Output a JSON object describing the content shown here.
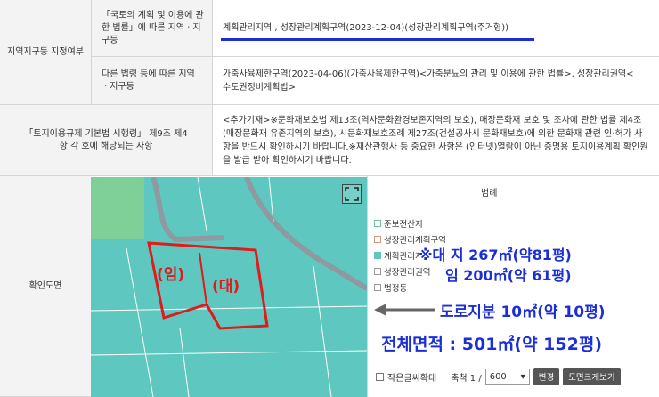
{
  "rows": {
    "zone_label": "지역지구등 지정여부",
    "sub1_label": "「국토의 계획 및 이용에 관한 법률」에 따른 지역ㆍ지구등",
    "sub1_value": "계획관리지역 , 성장관리계획구역(2023-12-04)(성장관리계획구역(주거형))",
    "sub2_label": "다른 법령 등에 따른 지역ㆍ지구등",
    "sub2_value": "가축사육제한구역(2023-04-06)(가축사육제한구역)<가축분뇨의 관리 및 이용에 관한 법률>, 성장관리권역<수도권정비계획법>",
    "reg_label": "「토지이용규제 기본법 시행령」 제9조 제4항 각 호에 해당되는 사항",
    "reg_value": "<추가기재>※문화재보호법 제13조(역사문화환경보존지역의 보호), 매장문화재 보호 및 조사에 관한 법률 제4조(매장문화재 유존지역의 보호), 시문화재보호조례 제27조(건설공사시 문화재보호)에 의한 문화재 관련 인·허가 사항을 반드시 확인하시기 바랍니다.※재산관행사 등 중요한 사항은 (인터넷)열람이 아닌 증명용 토지이용계획 확인원을 발급 받아 확인하시기 바랍니다.",
    "map_label": "확인도면"
  },
  "legend": {
    "title": "범례",
    "items": [
      {
        "label": "준보전산지",
        "color": "#9fd8a8"
      },
      {
        "label": "성장관리계획구역",
        "color": "#f7d6c6"
      },
      {
        "label": "계획관리지역",
        "color": "#5ec7c0"
      },
      {
        "label": "성장관리권역",
        "color": "#ffffff"
      },
      {
        "label": "법정동",
        "color": "#ffffff"
      }
    ]
  },
  "map": {
    "parcel1": "(임)",
    "parcel2": "(대)"
  },
  "overlays": {
    "line1": "※대 지 267㎡(약81평)",
    "line2": "임  200㎡(약 61평)",
    "line3": "도로지분 10㎡(약 10평)",
    "line4": "전체면적 : 501㎡(약 152평)"
  },
  "controls": {
    "small_text": "작은글씨확대",
    "scale_label": "축척 1 /",
    "scale_value": "600",
    "search_btn": "변경",
    "toggle_btn": "도면크게보기"
  },
  "colors": {
    "accent_blue": "#1b2ed8",
    "parcel_red": "#e01b1b",
    "map_bg": "#5ec7c0"
  }
}
